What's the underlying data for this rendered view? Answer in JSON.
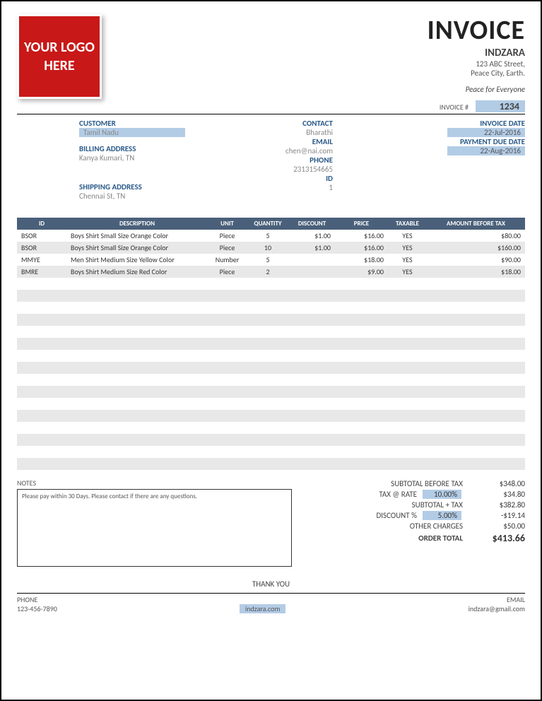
{
  "logo": "YOUR LOGO HERE",
  "header": {
    "title": "INVOICE",
    "company": "INDZARA",
    "addr1": "123 ABC Street,",
    "addr2": "Peace City, Earth.",
    "tagline": "Peace for Everyone",
    "invnum_label": "INVOICE #",
    "invnum": "1234"
  },
  "customer": {
    "label": "CUSTOMER",
    "name": "Tamil Nadu",
    "billing_label": "BILLING ADDRESS",
    "billing": "Kanya Kumari, TN",
    "shipping_label": "SHIPPING ADDRESS",
    "shipping": "Chennai St, TN"
  },
  "contact": {
    "contact_label": "CONTACT",
    "contact": "Bharathi",
    "email_label": "EMAIL",
    "email": "chen@nai.com",
    "phone_label": "PHONE",
    "phone": "2313154665",
    "id_label": "ID",
    "id": "1"
  },
  "dates": {
    "inv_date_label": "INVOICE DATE",
    "inv_date": "22-Jul-2016",
    "due_label": "PAYMENT DUE DATE",
    "due": "22-Aug-2016"
  },
  "cols": {
    "id": "ID",
    "desc": "DESCRIPTION",
    "unit": "UNIT",
    "qty": "QUANTITY",
    "disc": "DISCOUNT",
    "price": "PRICE",
    "tax": "TAXABLE",
    "amt": "AMOUNT BEFORE TAX"
  },
  "rows": [
    {
      "id": "BSOR",
      "desc": "Boys Shirt Small Size Orange Color",
      "unit": "Piece",
      "qty": "5",
      "disc": "$1.00",
      "price": "$16.00",
      "tax": "YES",
      "amt": "$80.00"
    },
    {
      "id": "BSOR",
      "desc": "Boys Shirt Small Size Orange Color",
      "unit": "Piece",
      "qty": "10",
      "disc": "$1.00",
      "price": "$16.00",
      "tax": "YES",
      "amt": "$160.00"
    },
    {
      "id": "MMYE",
      "desc": "Men Shirt Medium Size Yellow Color",
      "unit": "Number",
      "qty": "5",
      "disc": "",
      "price": "$18.00",
      "tax": "YES",
      "amt": "$90.00"
    },
    {
      "id": "BMRE",
      "desc": "Boys Shirt Medium Size Red Color",
      "unit": "Piece",
      "qty": "2",
      "disc": "",
      "price": "$9.00",
      "tax": "YES",
      "amt": "$18.00"
    }
  ],
  "totals": {
    "subtotal_label": "SUBTOTAL BEFORE TAX",
    "subtotal": "$348.00",
    "taxrate_label": "TAX @ RATE",
    "taxrate": "10.00%",
    "tax": "$34.80",
    "subtax_label": "SUBTOTAL + TAX",
    "subtax": "$382.80",
    "discpct_label": "DISCOUNT %",
    "discpct": "5.00%",
    "disc": "-$19.14",
    "other_label": "OTHER CHARGES",
    "other": "$50.00",
    "total_label": "ORDER TOTAL",
    "total": "$413.66"
  },
  "notes": {
    "label": "NOTES",
    "text": "Please pay within 30 Days. Please contact if there are any questions."
  },
  "thank": "THANK YOU",
  "footer": {
    "phone_label": "PHONE",
    "phone": "123-456-7890",
    "web": "indzara.com",
    "email_label": "EMAIL",
    "email": "indzara@gmail.com"
  }
}
